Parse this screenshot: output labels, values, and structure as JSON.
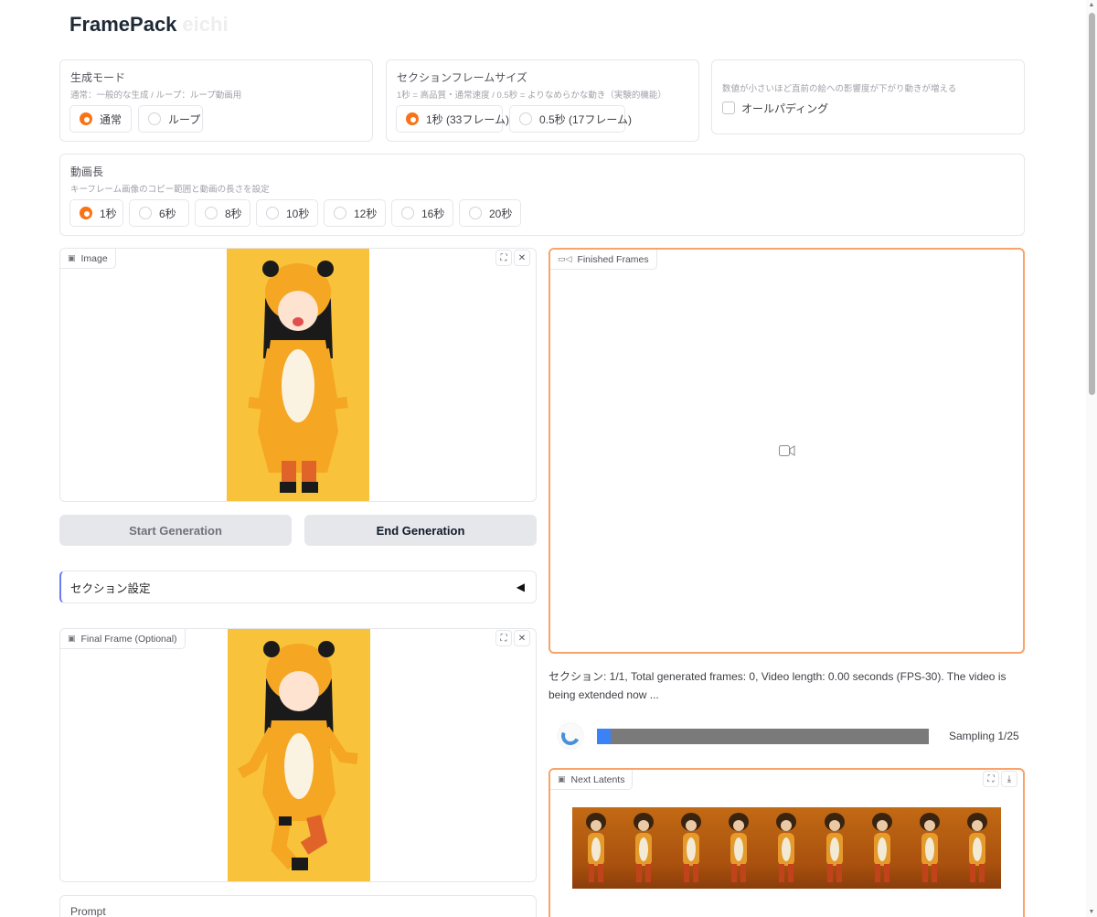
{
  "app": {
    "title": "FramePack",
    "title_suffix": "eichi"
  },
  "generation_mode": {
    "label": "生成モード",
    "info": "通常：一般的な生成 / ループ：ループ動画用",
    "options": [
      "通常",
      "ループ"
    ],
    "selected": "通常"
  },
  "section_frame_size": {
    "label": "セクションフレームサイズ",
    "info": "1秒 = 高品質・通常速度 / 0.5秒 = よりなめらかな動き（実験的機能）",
    "options": [
      "1秒 (33フレーム)",
      "0.5秒 (17フレーム)"
    ],
    "selected": "1秒 (33フレーム)"
  },
  "all_padding": {
    "info": "数値が小さいほど直前の絵への影響度が下がり動きが増える",
    "label": "オールパディング",
    "checked": false
  },
  "video_length": {
    "label": "動画長",
    "info": "キーフレーム画像のコピー範囲と動画の長さを設定",
    "options": [
      "1秒",
      "6秒",
      "8秒",
      "10秒",
      "12秒",
      "16秒",
      "20秒"
    ],
    "selected": "1秒"
  },
  "image_input": {
    "label": "Image",
    "icon": "image-icon"
  },
  "final_frame": {
    "label": "Final Frame (Optional)",
    "icon": "image-icon"
  },
  "buttons": {
    "start": "Start Generation",
    "end": "End Generation"
  },
  "section_settings": {
    "label": "セクション設定",
    "arrow": "◀"
  },
  "prompt": {
    "label": "Prompt"
  },
  "finished_frames": {
    "label": "Finished Frames",
    "icon": "video-icon"
  },
  "status_text": "セクション: 1/1, Total generated frames: 0, Video length: 0.00 seconds (FPS-30). The video is being extended now ...",
  "progress": {
    "label": "Sampling 1/25",
    "value": 0.04
  },
  "next_latents": {
    "label": "Next Latents",
    "frames": 9
  },
  "colors": {
    "accent": "#f97316",
    "progress_fill": "#3b82f6",
    "active_border": "#f7a36a"
  }
}
